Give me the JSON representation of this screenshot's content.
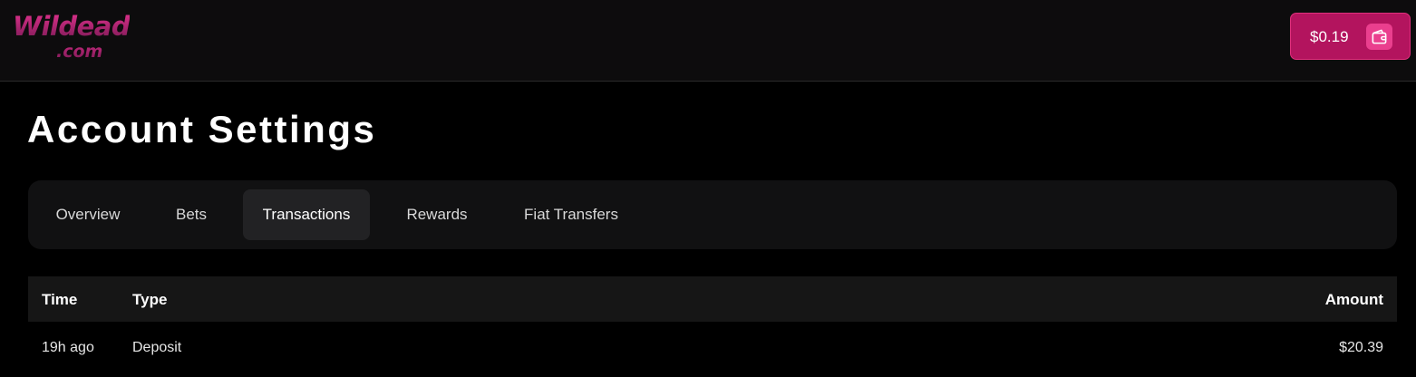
{
  "header": {
    "logo_main": "Wildead",
    "logo_sub": ".com",
    "balance": "$0.19",
    "wallet_icon": "wallet-icon",
    "accent_color": "#b3145e"
  },
  "page": {
    "title": "Account Settings"
  },
  "tabs": [
    {
      "label": "Overview"
    },
    {
      "label": "Bets"
    },
    {
      "label": "Transactions",
      "active": true
    },
    {
      "label": "Rewards"
    },
    {
      "label": "Fiat Transfers"
    }
  ],
  "table": {
    "columns": [
      "Time",
      "Type",
      "Amount"
    ],
    "rows": [
      {
        "time": "19h ago",
        "type": "Deposit",
        "amount": "$20.39"
      }
    ]
  }
}
